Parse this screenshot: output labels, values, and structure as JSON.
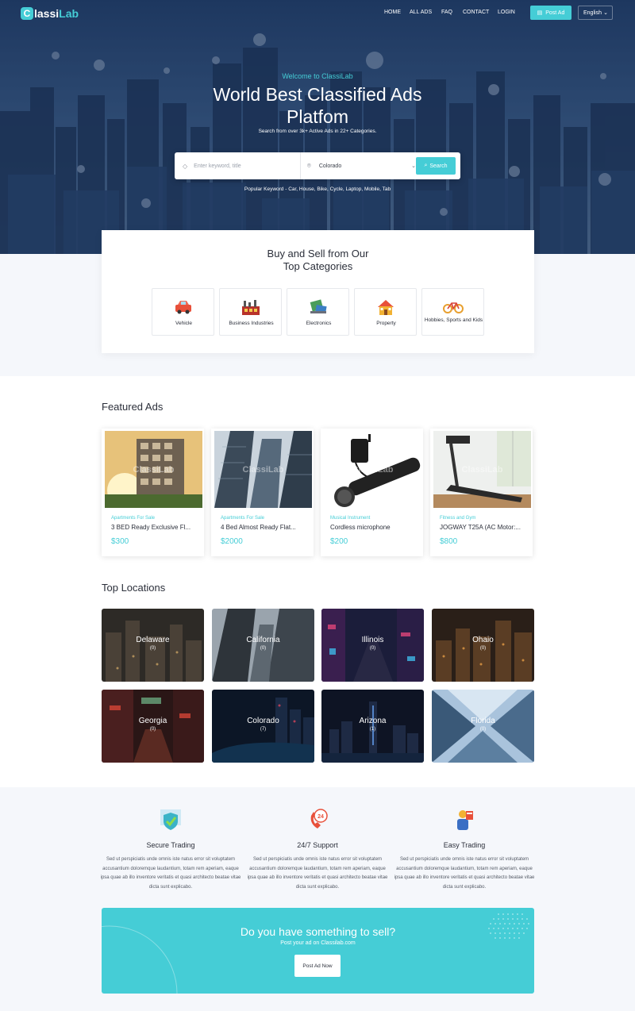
{
  "colors": {
    "accent": "#45cdd6",
    "hero": "#2d4b76",
    "text": "#2b2f3a"
  },
  "nav": {
    "logo_icon": "C",
    "logo_text_a": "lassi",
    "logo_text_b": "Lab",
    "links": [
      "HOME",
      "ALL ADS",
      "FAQ",
      "CONTACT",
      "LOGIN"
    ],
    "post_ad": "Post Ad",
    "post_ad_icon": "document-icon",
    "language": "English"
  },
  "hero": {
    "welcome": "Welcome to ClassiLab",
    "title": "World Best Classified Ads Platfom",
    "description": "Search from over 3k+ Active Ads in 22+ Categories.",
    "search": {
      "keyword_placeholder": "Enter keyword, title",
      "location_value": "Colorado",
      "button": "Search"
    },
    "popular": "Popular Keyword - Car, House, Bike, Cycle, Laptop, Mobile, Tab"
  },
  "categories": {
    "title_line1": "Buy and Sell from Our",
    "title_line2": "Top Categories",
    "items": [
      {
        "label": "Vehicle",
        "icon": "car-icon"
      },
      {
        "label": "Business Industries",
        "icon": "factory-icon"
      },
      {
        "label": "Electronics",
        "icon": "electronics-icon"
      },
      {
        "label": "Property",
        "icon": "house-icon"
      },
      {
        "label": "Hobbies, Sports and Kids",
        "icon": "bicycle-icon"
      }
    ]
  },
  "featured": {
    "title": "Featured Ads",
    "watermark": "ClassiLab",
    "ads": [
      {
        "category": "Apartments For Sale",
        "name": "3 BED Ready Exclusive Fl...",
        "price": "$300"
      },
      {
        "category": "Apartments For Sale",
        "name": "4 Bed Almost Ready Flat...",
        "price": "$2000"
      },
      {
        "category": "Musical Instrument",
        "name": "Cordless microphone",
        "price": "$200"
      },
      {
        "category": "Fitness and Gym",
        "name": "JOGWAY T25A (AC Motor:...",
        "price": "$800"
      }
    ]
  },
  "locations": {
    "title": "Top Locations",
    "items": [
      {
        "name": "Delaware",
        "count": "(0)"
      },
      {
        "name": "California",
        "count": "(0)"
      },
      {
        "name": "Illinois",
        "count": "(0)"
      },
      {
        "name": "Ohaio",
        "count": "(0)"
      },
      {
        "name": "Georgia",
        "count": "(0)"
      },
      {
        "name": "Colorado",
        "count": "(7)"
      },
      {
        "name": "Arizona",
        "count": "(1)"
      },
      {
        "name": "Florida",
        "count": "(0)"
      }
    ]
  },
  "features": [
    {
      "title": "Secure Trading",
      "icon": "shield-check-icon",
      "text": "Sed ut perspiciatis unde omnis iste natus error sit voluptatem accusantium doloremque laudantium, totam rem aperiam, eaque ipsa quae ab illo inventore veritatis et quasi architecto beatae vitae dicta sunt explicabo."
    },
    {
      "title": "24/7 Support",
      "icon": "support-24-icon",
      "text": "Sed ut perspiciatis unde omnis iste natus error sit voluptatem accusantium doloremque laudantium, totam rem aperiam, eaque ipsa quae ab illo inventore veritatis et quasi architecto beatae vitae dicta sunt explicabo."
    },
    {
      "title": "Easy Trading",
      "icon": "trader-icon",
      "text": "Sed ut perspiciatis unde omnis iste natus error sit voluptatem accusantium doloremque laudantium, totam rem aperiam, eaque ipsa quae ab illo inventore veritatis et quasi architecto beatae vitae dicta sunt explicabo."
    }
  ],
  "cta": {
    "title": "Do you have something to sell?",
    "subtitle": "Post your ad on Classilab.com",
    "button": "Post Ad Now"
  }
}
